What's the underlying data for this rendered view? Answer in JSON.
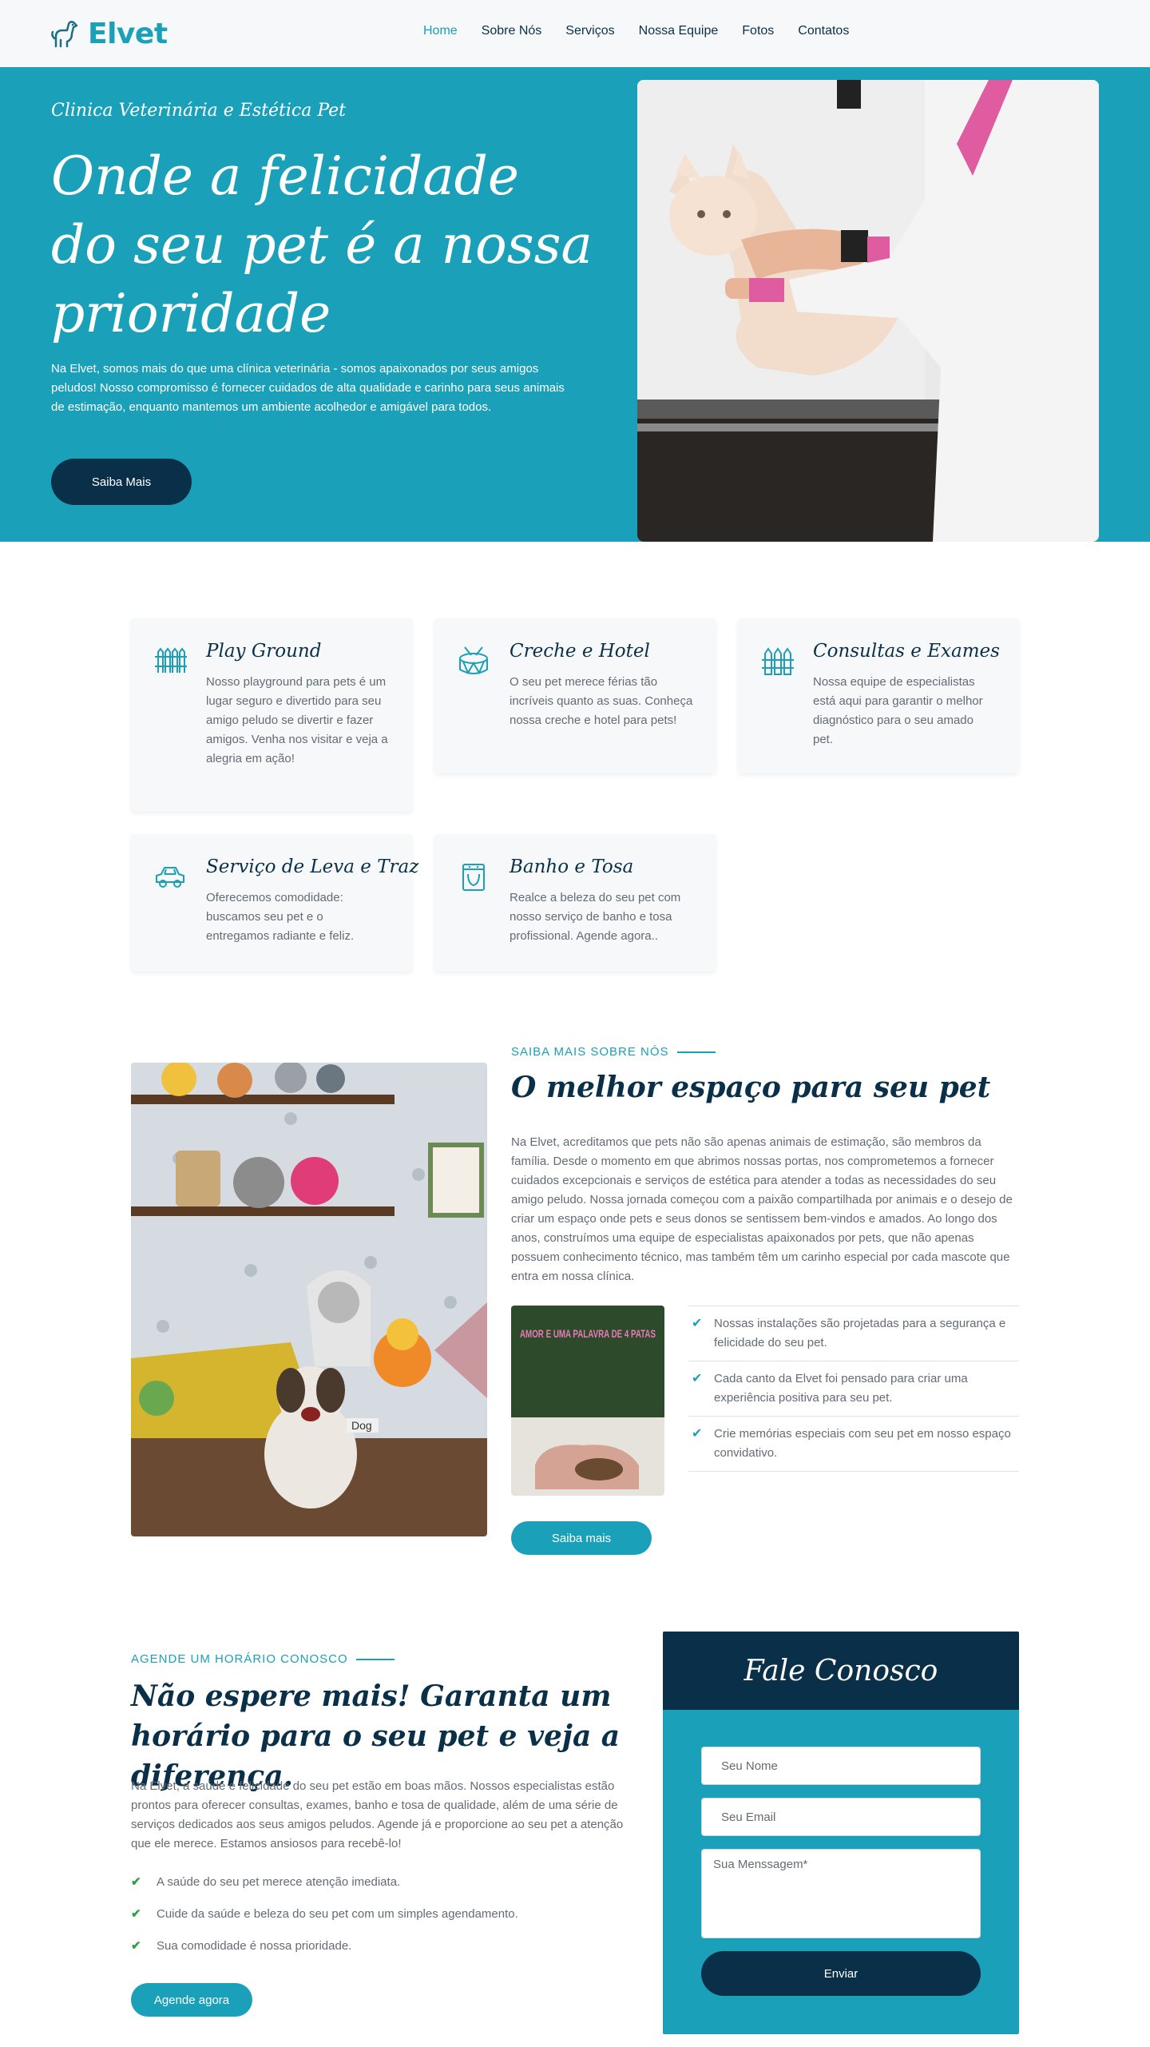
{
  "nav": {
    "logo_text": "Elvet",
    "items": [
      {
        "label": "Home",
        "active": true
      },
      {
        "label": "Sobre Nós"
      },
      {
        "label": "Serviços"
      },
      {
        "label": "Nossa Equipe"
      },
      {
        "label": "Fotos"
      },
      {
        "label": "Contatos"
      }
    ]
  },
  "hero": {
    "subtitle": "Clinica Veterinária e Estética Pet",
    "title": "Onde a felicidade do seu pet é a nossa prioridade",
    "text": "Na Elvet, somos mais do que uma clínica veterinária - somos apaixonados por seus amigos peludos! Nosso compromisso é fornecer cuidados de alta qualidade e carinho para seus animais de estimação, enquanto mantemos um ambiente acolhedor e amigável para todos.",
    "button": "Saiba Mais"
  },
  "services": [
    {
      "icon": "fence-icon",
      "title": "Play Ground",
      "text": "Nosso playground para pets é um lugar seguro e divertido para seu amigo peludo se divertir e fazer amigos. Venha nos visitar e veja a alegria em ação!"
    },
    {
      "icon": "drum-icon",
      "title": "Creche e Hotel",
      "text": "O seu pet merece férias tão incríveis quanto as suas. Conheça nossa creche e hotel para pets!"
    },
    {
      "icon": "fence-gate-icon",
      "title": "Consultas e Exames",
      "text": "Nossa equipe de especialistas está aqui para garantir o melhor diagnóstico para o seu amado pet."
    },
    {
      "icon": "car-icon",
      "title": "Serviço de Leva e Traz",
      "text": "Oferecemos comodidade: buscamos seu pet e o entregamos radiante e feliz."
    },
    {
      "icon": "bath-icon",
      "title": "Banho e Tosa",
      "text": "Realce a beleza do seu pet com nosso serviço de banho e tosa profissional. Agende agora.."
    }
  ],
  "about": {
    "eyebrow": "SAIBA MAIS SOBRE NÓS",
    "title": "O melhor espaço para seu pet",
    "text": "Na Elvet, acreditamos que pets não são apenas animais de estimação, são membros da família. Desde o momento em que abrimos nossas portas, nos comprometemos a fornecer cuidados excepcionais e serviços de estética para atender a todas as necessidades do seu amigo peludo. Nossa jornada começou com a paixão compartilhada por animais e o desejo de criar um espaço onde pets e seus donos se sentissem bem-vindos e amados. Ao longo dos anos, construímos uma equipe de especialistas apaixonados por pets, que não apenas possuem conhecimento técnico, mas também têm um carinho especial por cada mascote que entra em nossa clínica.",
    "checks": [
      "Nossas instalações são projetadas para a segurança e felicidade do seu pet.",
      "Cada canto da Elvet foi pensado para criar uma experiência positiva para seu pet.",
      "Crie memórias especiais com seu pet em nosso espaço convidativo."
    ],
    "button": "Saiba mais",
    "photo_text": "Dog",
    "small_photo_text": "AMOR E UMA PALAVRA DE 4 PATAS"
  },
  "schedule": {
    "eyebrow": "AGENDE UM HORÁRIO CONOSCO",
    "title": "Não espere mais! Garanta um horário para o seu pet e veja a diferença.",
    "text": "Na Elvet, a saúde e felicidade do seu pet estão em boas mãos. Nossos especialistas estão prontos para oferecer consultas, exames, banho e tosa de qualidade, além de uma série de serviços dedicados aos seus amigos peludos. Agende já e proporcione ao seu pet a atenção que ele merece. Estamos ansiosos para recebê-lo!",
    "checks": [
      "A saúde do seu pet merece atenção imediata.",
      "Cuide da saúde e beleza do seu pet com um simples agendamento.",
      "Sua comodidade é nossa prioridade."
    ],
    "button": "Agende agora"
  },
  "contact": {
    "title": "Fale Conosco",
    "name_placeholder": "Seu Nome",
    "email_placeholder": "Seu Email",
    "message_placeholder": "Sua Menssagem*",
    "button": "Enviar"
  },
  "colors": {
    "primary": "#1aa0b8",
    "dark": "#0a3049",
    "text": "#636b74",
    "check": "#2f9e44"
  }
}
